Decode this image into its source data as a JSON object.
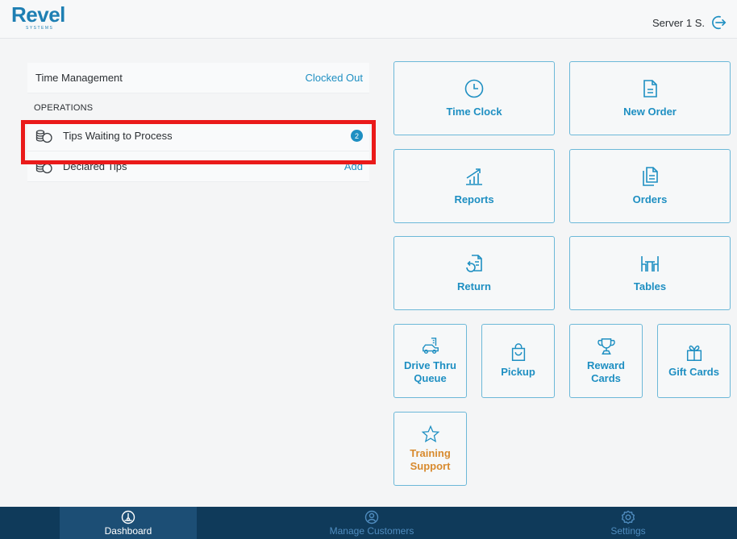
{
  "header": {
    "logo_main": "Revel",
    "logo_sub": "SYSTEMS",
    "server_name": "Server 1 S.",
    "logout_icon": "logout-arrow-icon"
  },
  "panel": {
    "time_management": {
      "label": "Time Management",
      "status": "Clocked Out"
    },
    "section_title": "OPERATIONS",
    "items": [
      {
        "label": "Tips Waiting to Process",
        "badge": "2",
        "icon": "coins-icon"
      },
      {
        "label": "Declared Tips",
        "action": "Add",
        "icon": "coins-icon"
      }
    ]
  },
  "tiles": {
    "time_clock": {
      "label": "Time Clock",
      "icon": "clock-icon"
    },
    "new_order": {
      "label": "New Order",
      "icon": "document-icon"
    },
    "reports": {
      "label": "Reports",
      "icon": "chart-icon"
    },
    "orders": {
      "label": "Orders",
      "icon": "documents-icon"
    },
    "return": {
      "label": "Return",
      "icon": "return-icon"
    },
    "tables": {
      "label": "Tables",
      "icon": "table-icon"
    },
    "drive_thru": {
      "label_line1": "Drive Thru",
      "label_line2": "Queue",
      "icon": "car-icon"
    },
    "pickup": {
      "label": "Pickup",
      "icon": "bag-icon"
    },
    "reward_cards": {
      "label_line1": "Reward",
      "label_line2": "Cards",
      "icon": "trophy-icon"
    },
    "gift_cards": {
      "label": "Gift Cards",
      "icon": "gift-icon"
    },
    "training": {
      "label_line1": "Training",
      "label_line2": "Support",
      "icon": "star-icon"
    }
  },
  "colors": {
    "accent": "#1e8fc2",
    "training_accent": "#d88a2e",
    "nav_bg": "#0f3a5a",
    "highlight": "#ea1a1a"
  },
  "bottom_nav": [
    {
      "label": "Dashboard",
      "icon": "dashboard-icon",
      "active": true
    },
    {
      "label": "Manage Customers",
      "icon": "customer-icon",
      "active": false
    },
    {
      "label": "Settings",
      "icon": "gear-icon",
      "active": false
    }
  ]
}
